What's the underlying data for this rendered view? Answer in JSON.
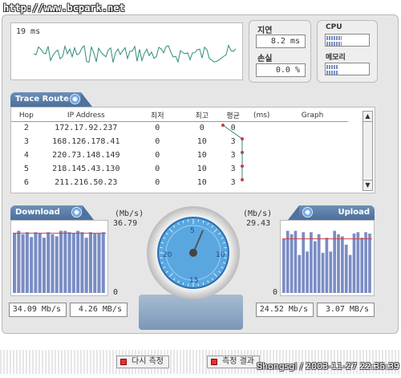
{
  "watermark": "http://www.bcpark.net",
  "credit": "Shongsgl / 2003-11-27 22:35:39",
  "latency": {
    "display": "19 ms",
    "delay_label": "지연",
    "delay_value": "8.2 ms",
    "loss_label": "손실",
    "loss_value": "0.0 %"
  },
  "sys": {
    "cpu_label": "CPU",
    "cpu_pct": [
      0.35,
      0.35
    ],
    "mem_label": "메모리",
    "mem_pct": [
      0.25,
      0.25
    ]
  },
  "trace": {
    "title": "Trace Route",
    "headers": [
      "Hop",
      "IP Address",
      "최저",
      "최고",
      "평균",
      "(ms)",
      "Graph"
    ],
    "rows": [
      {
        "hop": "2",
        "ip": "172.17.92.237",
        "min": "0",
        "max": "0",
        "avg": "0"
      },
      {
        "hop": "3",
        "ip": "168.126.178.41",
        "min": "0",
        "max": "10",
        "avg": "3"
      },
      {
        "hop": "4",
        "ip": "220.73.148.149",
        "min": "0",
        "max": "10",
        "avg": "3"
      },
      {
        "hop": "5",
        "ip": "218.145.43.130",
        "min": "0",
        "max": "10",
        "avg": "3"
      },
      {
        "hop": "6",
        "ip": "211.216.50.23",
        "min": "0",
        "max": "10",
        "avg": "3"
      }
    ]
  },
  "download": {
    "title": "Download",
    "unit": "(Mb/s)",
    "max": "36.79",
    "zero": "0",
    "value1": "34.09 Mb/s",
    "value2": "4.26 MB/s",
    "bars": [
      0.87,
      0.9,
      0.85,
      0.88,
      0.81,
      0.88,
      0.87,
      0.8,
      0.88,
      0.85,
      0.82,
      0.9,
      0.9,
      0.88,
      0.87,
      0.9,
      0.88,
      0.8,
      0.88,
      0.86,
      0.86,
      0.88
    ]
  },
  "upload": {
    "title": "Upload",
    "unit": "(Mb/s)",
    "max": "29.43",
    "zero": "0",
    "value1": "24.52 Mb/s",
    "value2": "3.07 MB/s",
    "bars": [
      0.78,
      0.9,
      0.85,
      0.9,
      0.55,
      0.88,
      0.6,
      0.88,
      0.75,
      0.85,
      0.58,
      0.8,
      0.6,
      0.9,
      0.85,
      0.82,
      0.7,
      0.55,
      0.86,
      0.88,
      0.8,
      0.88,
      0.86
    ]
  },
  "gauge": {
    "ticks": [
      "5",
      "10",
      "15",
      "20"
    ]
  },
  "buttons": {
    "retest": "다시 측정",
    "result": "측정 결과"
  },
  "colors": {
    "accent": "#4c6f9c",
    "bar": "#7a8cc4",
    "line_red": "#d04040",
    "graph": "#2e8b7a"
  }
}
